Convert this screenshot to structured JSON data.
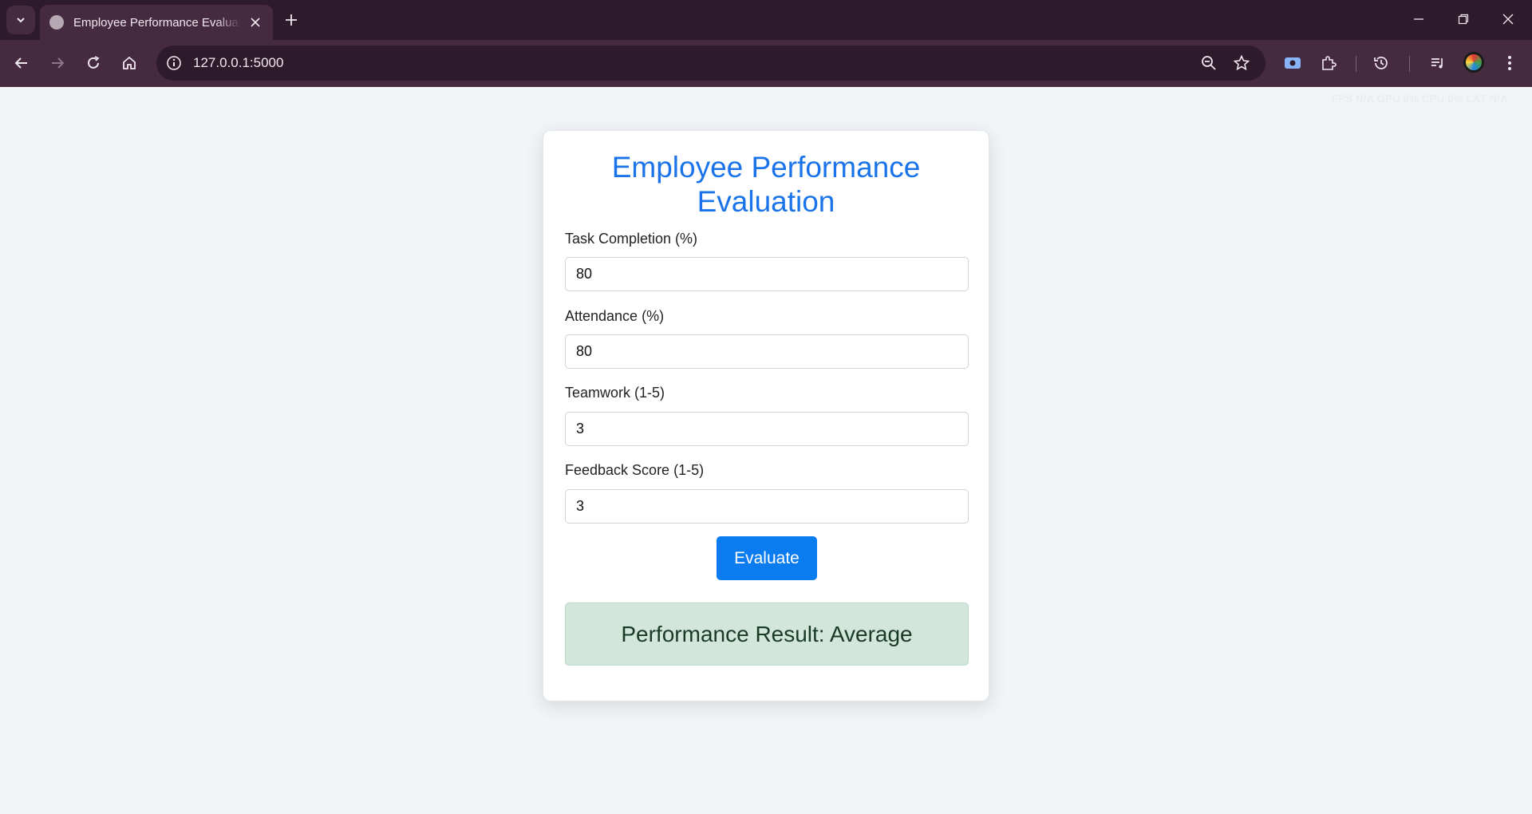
{
  "browser": {
    "tab_title": "Employee Performance Evaluation",
    "url": "127.0.0.1:5000",
    "perf_overlay": "FPS N/A GPU 0% CPU 0% LAT N/A"
  },
  "page": {
    "title": "Employee Performance Evaluation",
    "fields": [
      {
        "label": "Task Completion (%)",
        "value": "80"
      },
      {
        "label": "Attendance (%)",
        "value": "80"
      },
      {
        "label": "Teamwork (1-5)",
        "value": "3"
      },
      {
        "label": "Feedback Score (1-5)",
        "value": "3"
      }
    ],
    "evaluate_label": "Evaluate",
    "result_text": "Performance Result: Average"
  },
  "colors": {
    "title": "#1a73e8",
    "button": "#0a7cf0",
    "result_bg": "#d2e6dc"
  }
}
